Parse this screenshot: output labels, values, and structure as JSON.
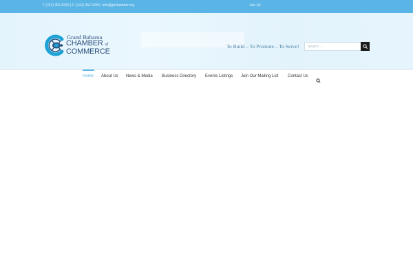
{
  "topbar": {
    "contact": "T: (242) 352-8329 | F: (242) 352-3280 | info@gbchamber.org",
    "join_label": "Join Us"
  },
  "logo": {
    "line1": "Grand Bahama",
    "line2": "CHAMBER",
    "line2_of": "of",
    "line3": "COMMERCE",
    "icon": "turtle-c-emblem-icon"
  },
  "header": {
    "tagline": "To Build .. To Promote .. To Serve!"
  },
  "search": {
    "placeholder": "Search ...",
    "icon": "search-icon"
  },
  "nav": {
    "items": [
      {
        "label": "Home",
        "active": true
      },
      {
        "label": "About Us"
      },
      {
        "label": "News & Media"
      },
      {
        "label": "Business Directory"
      },
      {
        "label": "Events Listings"
      },
      {
        "label": "Join Our Mailing List"
      },
      {
        "label": "Contact Us"
      }
    ],
    "search_icon": "search-icon"
  },
  "colors": {
    "accent": "#5ab4e5",
    "brand_navy": "#2b4e7a",
    "brand_cyan": "#1fa3d6"
  }
}
